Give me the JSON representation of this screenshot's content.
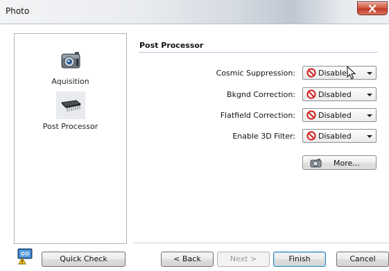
{
  "window": {
    "title": "Photo"
  },
  "nav": {
    "items": [
      {
        "label": "Aquisition",
        "icon": "camera-icon"
      },
      {
        "label": "Post Processor",
        "icon": "chip-icon",
        "selected": true
      }
    ]
  },
  "section": {
    "title": "Post Processor"
  },
  "settings": [
    {
      "label": "Cosmic Suppression:",
      "value": "Disabled"
    },
    {
      "label": "Bkgnd Correction:",
      "value": "Disabled"
    },
    {
      "label": "Flatfield Correction:",
      "value": "Disabled"
    },
    {
      "label": "Enable 3D Filter:",
      "value": "Disabled"
    }
  ],
  "more_button": {
    "label": "More..."
  },
  "buttons": {
    "quick_check": "Quick Check",
    "back": "< Back",
    "next": "Next >",
    "finish": "Finish",
    "cancel": "Cancel"
  },
  "colors": {
    "close_button": "#c0392b",
    "disabled_icon": "#d21f1f",
    "panel_border": "#a9b1bc"
  }
}
